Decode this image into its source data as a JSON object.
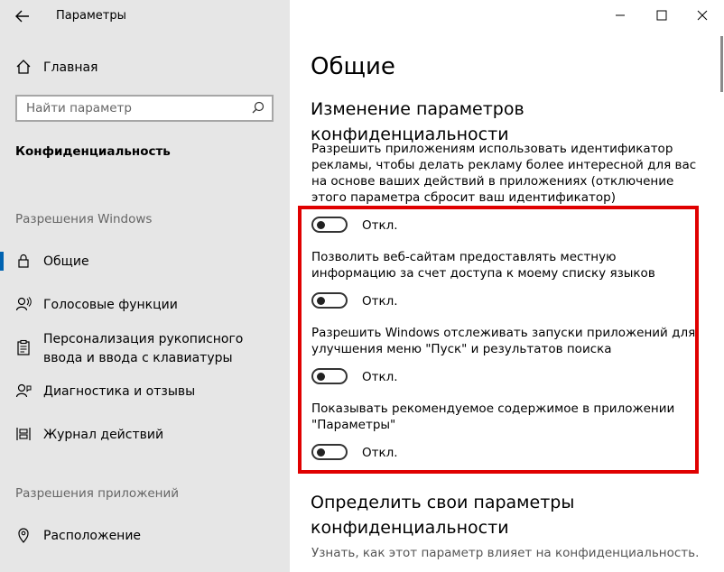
{
  "window": {
    "title": "Параметры",
    "back_icon": "back-arrow-icon"
  },
  "sidebar": {
    "home": {
      "label": "Главная",
      "icon": "home-icon"
    },
    "search": {
      "placeholder": "Найти параметр",
      "icon": "search-icon"
    },
    "category": "Конфиденциальность",
    "windows_section": "Разрешения Windows",
    "windows_items": [
      {
        "label": "Общие",
        "icon": "lock-icon",
        "active": true
      },
      {
        "label": "Голосовые функции",
        "icon": "speech-icon"
      },
      {
        "label": "Персонализация рукописного ввода и ввода с клавиатуры",
        "icon": "clipboard-icon"
      },
      {
        "label": "Диагностика и отзывы",
        "icon": "feedback-icon"
      },
      {
        "label": "Журнал действий",
        "icon": "timeline-icon"
      }
    ],
    "apps_section": "Разрешения приложений",
    "apps_items": [
      {
        "label": "Расположение",
        "icon": "location-icon"
      }
    ]
  },
  "titlebar": {
    "minimize": "—",
    "maximize": "☐",
    "close": "✕"
  },
  "main": {
    "title": "Общие",
    "subtitle": "Изменение параметров конфиденциальности",
    "settings": [
      {
        "text": "Разрешить приложениям использовать идентификатор рекламы, чтобы делать рекламу более интересной для вас на основе ваших действий в приложениях (отключение этого параметра сбросит ваш идентификатор)",
        "state": "Откл.",
        "on": false
      },
      {
        "text": "Позволить веб-сайтам предоставлять местную информацию за счет доступа к моему списку языков",
        "state": "Откл.",
        "on": false
      },
      {
        "text": "Разрешить Windows отслеживать запуски приложений для улучшения меню \"Пуск\" и результатов поиска",
        "state": "Откл.",
        "on": false
      },
      {
        "text": "Показывать рекомендуемое содержимое в приложении \"Параметры\"",
        "state": "Откл.",
        "on": false
      }
    ],
    "section2_title": "Определить свои параметры конфиденциальности",
    "section2_hint": "Узнать, как этот параметр влияет на конфиденциальность."
  },
  "colors": {
    "accent": "#0063b1",
    "highlight": "#e00000",
    "sidebar_bg": "#e6e6e6"
  }
}
